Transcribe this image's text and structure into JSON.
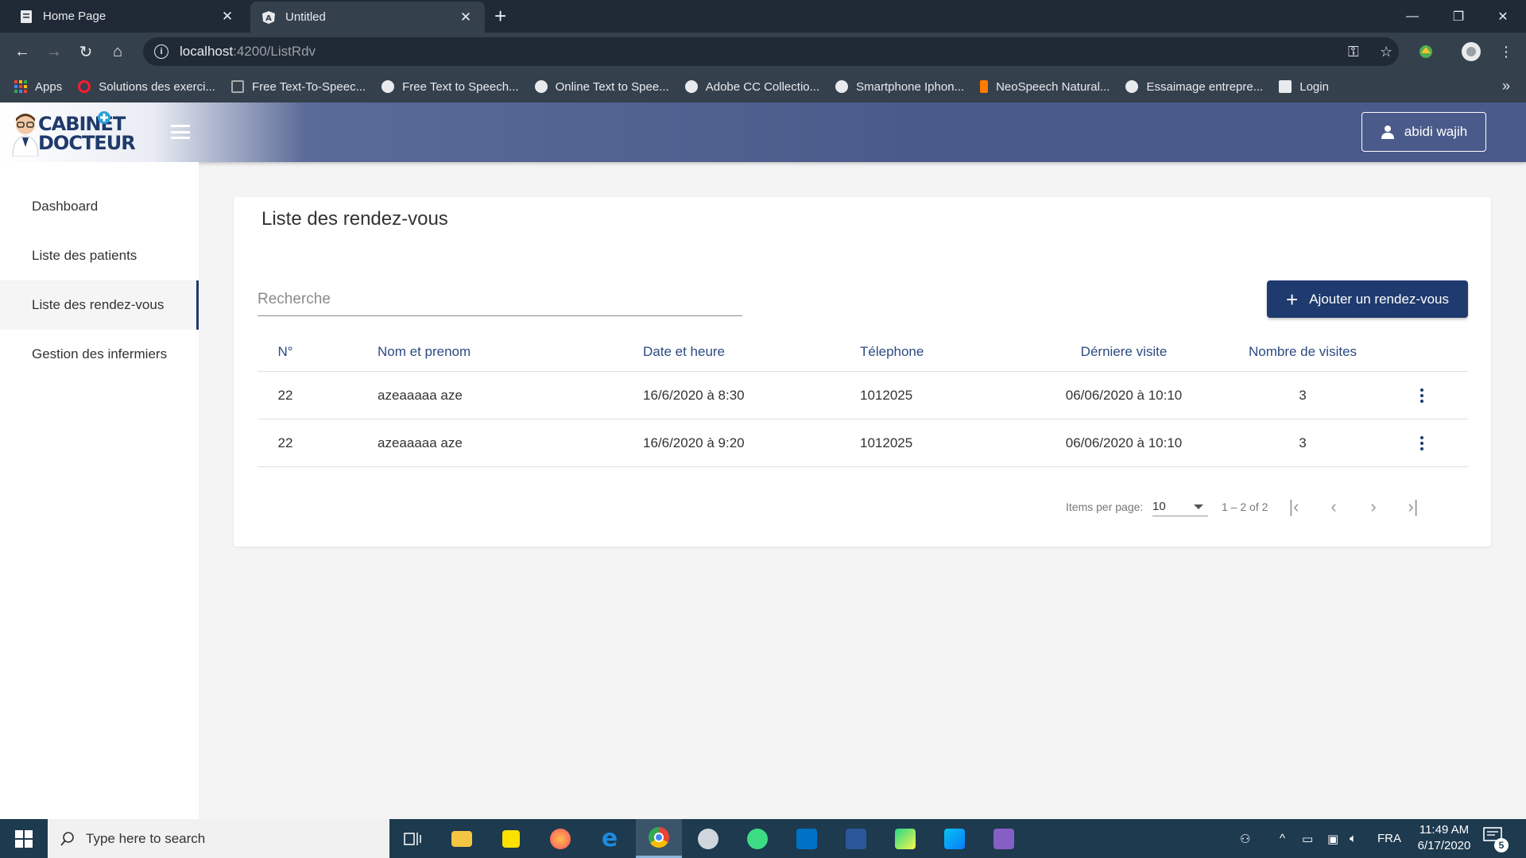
{
  "browser": {
    "tabs": [
      {
        "title": "Home Page",
        "icon": "page-icon"
      },
      {
        "title": "Untitled",
        "icon": "angular-icon"
      }
    ],
    "url": {
      "host": "localhost",
      "path": ":4200/ListRdv"
    },
    "bookmarks": [
      {
        "label": "Apps",
        "icon": "apps-grid-icon",
        "color": "#ea4335"
      },
      {
        "label": "Solutions des exerci...",
        "icon": "opera-icon",
        "color": "#ff1b2d"
      },
      {
        "label": "Free Text-To-Speec...",
        "icon": "page-icon",
        "color": "#888888"
      },
      {
        "label": "Free Text to Speech...",
        "icon": "globe-icon",
        "color": "#e8eaed"
      },
      {
        "label": "Online Text to Spee...",
        "icon": "globe-icon",
        "color": "#e8eaed"
      },
      {
        "label": "Adobe CC Collectio...",
        "icon": "skull-icon",
        "color": "#e8eaed"
      },
      {
        "label": "Smartphone Iphon...",
        "icon": "globe-icon",
        "color": "#e8eaed"
      },
      {
        "label": "NeoSpeech Natural...",
        "icon": "speaker-icon",
        "color": "#ff7a00"
      },
      {
        "label": "Essaimage entrepre...",
        "icon": "globe-icon",
        "color": "#e8eaed"
      },
      {
        "label": "Login",
        "icon": "page-icon",
        "color": "#e8eaed"
      }
    ]
  },
  "app": {
    "logo_text_1": "CABINET",
    "logo_text_2": "DOCTEUR",
    "user_name": "abidi wajih"
  },
  "sidebar": {
    "items": [
      {
        "label": "Dashboard",
        "active": false
      },
      {
        "label": "Liste des patients",
        "active": false
      },
      {
        "label": "Liste des rendez-vous",
        "active": true
      },
      {
        "label": "Gestion des infermiers",
        "active": false
      }
    ]
  },
  "main": {
    "title": "Liste des rendez-vous",
    "search_placeholder": "Recherche",
    "add_button": "Ajouter un rendez-vous",
    "columns": [
      "N°",
      "Nom et prenom",
      "Date et heure",
      "Télephone",
      "Dérniere visite",
      "Nombre de visites"
    ],
    "rows": [
      {
        "num": "22",
        "name": "azeaaaaa aze",
        "datetime": "16/6/2020 à 8:30",
        "phone": "1012025",
        "last_visit": "06/06/2020 à 10:10",
        "visits": "3"
      },
      {
        "num": "22",
        "name": "azeaaaaa aze",
        "datetime": "16/6/2020 à 9:20",
        "phone": "1012025",
        "last_visit": "06/06/2020 à 10:10",
        "visits": "3"
      }
    ],
    "paginator": {
      "items_per_page_label": "Items per page:",
      "items_per_page": "10",
      "range": "1 – 2 of 2"
    }
  },
  "taskbar": {
    "search_placeholder": "Type here to search",
    "language": "FRA",
    "time": "11:49 AM",
    "date": "6/17/2020",
    "notification_count": "5"
  },
  "colors": {
    "primary": "#1e3a6e",
    "header": "#4a5a8a",
    "taskbar": "#1d3a4f"
  }
}
